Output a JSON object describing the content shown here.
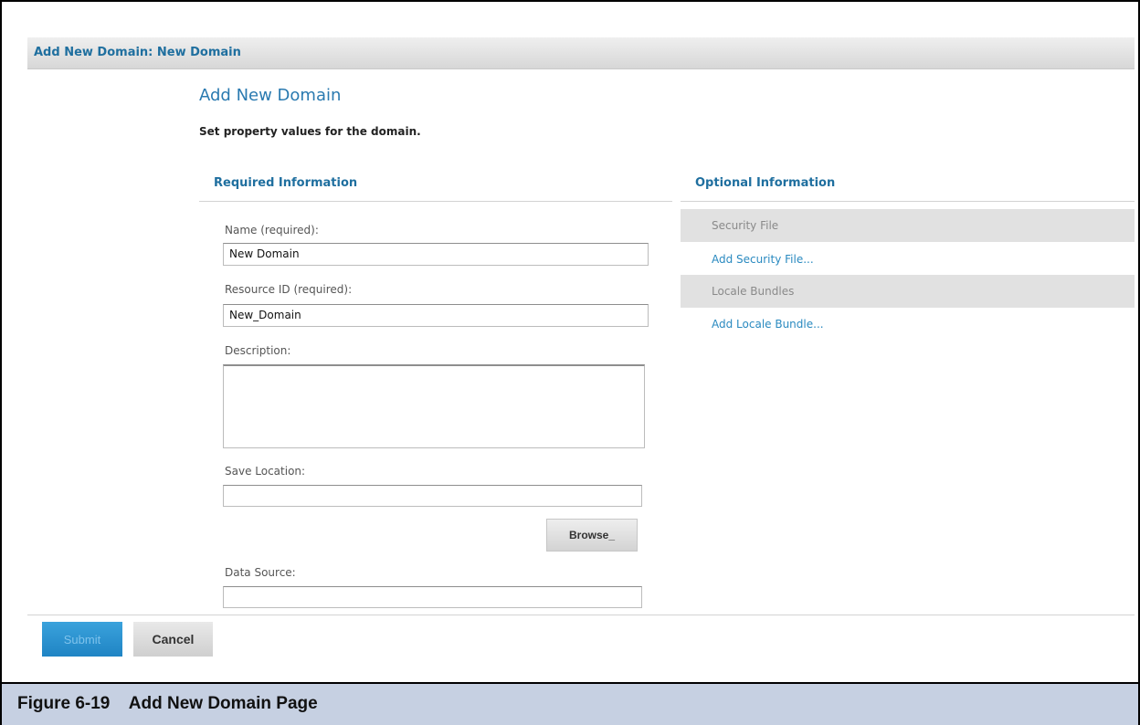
{
  "window": {
    "title": "Add New Domain: New Domain"
  },
  "page": {
    "title": "Add New Domain",
    "subtitle": "Set property values for the domain."
  },
  "required_section": {
    "heading": "Required Information",
    "fields": {
      "name": {
        "label": "Name (required):",
        "value": "New Domain"
      },
      "resource_id": {
        "label": "Resource ID (required):",
        "value": "New_Domain"
      },
      "description": {
        "label": "Description:",
        "value": ""
      },
      "save_location": {
        "label": "Save Location:",
        "value": ""
      },
      "data_source": {
        "label": "Data Source:",
        "value": ""
      }
    },
    "browse_label": "Browse_"
  },
  "optional_section": {
    "heading": "Optional Information",
    "groups": [
      {
        "title": "Security File",
        "link": "Add Security File..."
      },
      {
        "title": "Locale Bundles",
        "link": "Add Locale Bundle..."
      }
    ]
  },
  "actions": {
    "submit_label": "Submit",
    "cancel_label": "Cancel"
  },
  "caption": {
    "text": "Figure 6-19    Add New Domain Page"
  },
  "colors": {
    "heading_blue": "#1f6f9f",
    "link_blue": "#2a8ac0",
    "submit_blue": "#1f84c4",
    "caption_bg": "#c6d0e2"
  }
}
